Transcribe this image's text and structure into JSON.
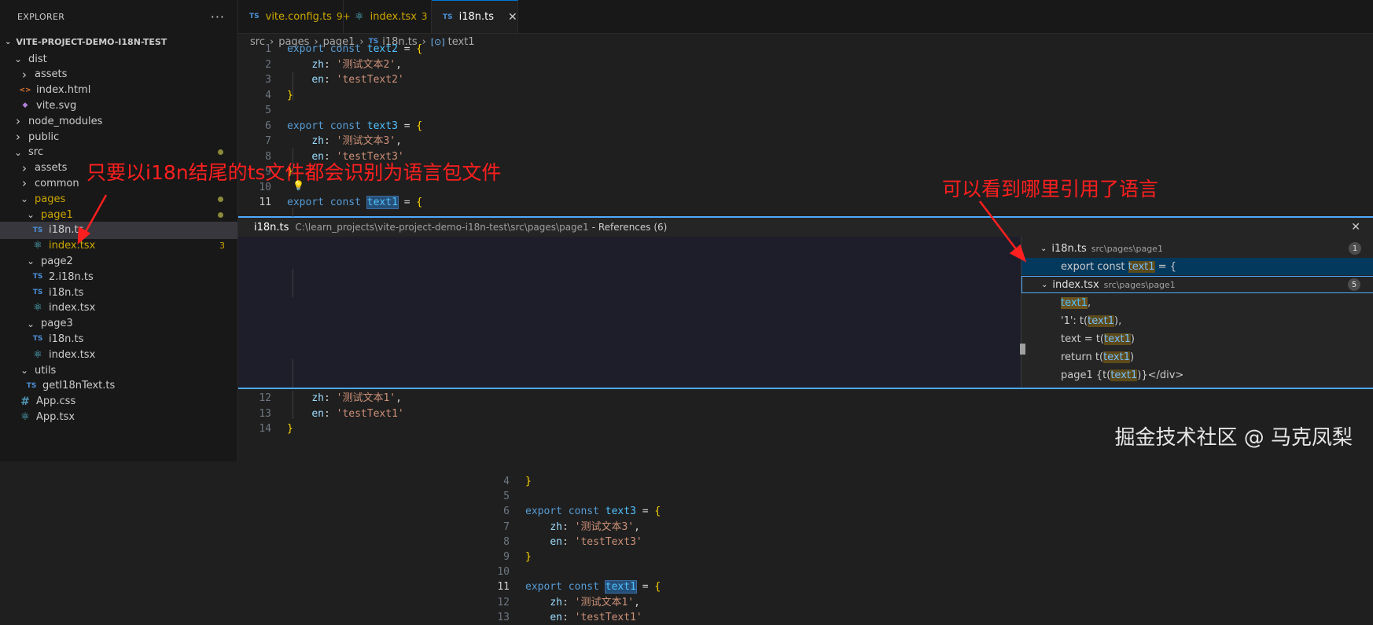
{
  "explorer": {
    "title": "EXPLORER",
    "more": "···",
    "project": "VITE-PROJECT-DEMO-I18N-TEST",
    "items": [
      {
        "label": "dist",
        "kind": "folder",
        "open": true,
        "depth": 0
      },
      {
        "label": "assets",
        "kind": "folder",
        "open": false,
        "depth": 1
      },
      {
        "label": "index.html",
        "kind": "html",
        "depth": 1
      },
      {
        "label": "vite.svg",
        "kind": "svg",
        "depth": 1
      },
      {
        "label": "node_modules",
        "kind": "folder",
        "open": false,
        "depth": 0
      },
      {
        "label": "public",
        "kind": "folder",
        "open": false,
        "depth": 0
      },
      {
        "label": "src",
        "kind": "folder",
        "open": true,
        "depth": 0,
        "modified": true
      },
      {
        "label": "assets",
        "kind": "folder",
        "open": false,
        "depth": 1
      },
      {
        "label": "common",
        "kind": "folder",
        "open": false,
        "depth": 1
      },
      {
        "label": "pages",
        "kind": "folder",
        "open": true,
        "depth": 1,
        "modified": true
      },
      {
        "label": "page1",
        "kind": "folder",
        "open": true,
        "depth": 2,
        "modified": true
      },
      {
        "label": "i18n.ts",
        "kind": "ts",
        "depth": 3,
        "selected": true
      },
      {
        "label": "index.tsx",
        "kind": "tsx",
        "depth": 3,
        "badge": "3",
        "modified": true
      },
      {
        "label": "page2",
        "kind": "folder",
        "open": true,
        "depth": 2
      },
      {
        "label": "2.i18n.ts",
        "kind": "ts",
        "depth": 3
      },
      {
        "label": "i18n.ts",
        "kind": "ts",
        "depth": 3
      },
      {
        "label": "index.tsx",
        "kind": "tsx",
        "depth": 3
      },
      {
        "label": "page3",
        "kind": "folder",
        "open": true,
        "depth": 2
      },
      {
        "label": "i18n.ts",
        "kind": "ts",
        "depth": 3
      },
      {
        "label": "index.tsx",
        "kind": "tsx",
        "depth": 3
      },
      {
        "label": "utils",
        "kind": "folder",
        "open": true,
        "depth": 1
      },
      {
        "label": "getI18nText.ts",
        "kind": "ts",
        "depth": 2
      },
      {
        "label": "App.css",
        "kind": "css",
        "depth": 1
      },
      {
        "label": "App.tsx",
        "kind": "tsx",
        "depth": 1
      }
    ]
  },
  "tabs": [
    {
      "label": "vite.config.ts",
      "count": "9+",
      "icon": "TS",
      "active": false
    },
    {
      "label": "index.tsx",
      "count": "3",
      "icon": "react",
      "active": false
    },
    {
      "label": "i18n.ts",
      "count": "",
      "icon": "TS",
      "active": true,
      "close": "✕"
    }
  ],
  "breadcrumb": {
    "parts": [
      "src",
      "pages",
      "page1"
    ],
    "file": "i18n.ts",
    "symbol": "text1"
  },
  "editor_top": [
    {
      "n": "1",
      "code": [
        [
          "kw",
          "export "
        ],
        [
          "kw",
          "const "
        ],
        [
          "var",
          "text2"
        ],
        [
          "pun",
          " = "
        ],
        [
          "brace",
          "{"
        ]
      ]
    },
    {
      "n": "2",
      "code": [
        [
          "pun",
          "    "
        ],
        [
          "prop",
          "zh"
        ],
        [
          "pun",
          ": "
        ],
        [
          "str",
          "'测试文本2'"
        ],
        [
          "pun",
          ","
        ]
      ]
    },
    {
      "n": "3",
      "code": [
        [
          "pun",
          "    "
        ],
        [
          "prop",
          "en"
        ],
        [
          "pun",
          ": "
        ],
        [
          "str",
          "'testText2'"
        ]
      ]
    },
    {
      "n": "4",
      "code": [
        [
          "brace",
          "}"
        ]
      ]
    },
    {
      "n": "5",
      "code": []
    },
    {
      "n": "6",
      "code": [
        [
          "kw",
          "export "
        ],
        [
          "kw",
          "const "
        ],
        [
          "var",
          "text3"
        ],
        [
          "pun",
          " = "
        ],
        [
          "brace",
          "{"
        ]
      ]
    },
    {
      "n": "7",
      "code": [
        [
          "pun",
          "    "
        ],
        [
          "prop",
          "zh"
        ],
        [
          "pun",
          ": "
        ],
        [
          "str",
          "'测试文本3'"
        ],
        [
          "pun",
          ","
        ]
      ]
    },
    {
      "n": "8",
      "code": [
        [
          "pun",
          "    "
        ],
        [
          "prop",
          "en"
        ],
        [
          "pun",
          ": "
        ],
        [
          "str",
          "'testText3'"
        ]
      ]
    },
    {
      "n": "9",
      "code": [
        [
          "brace",
          "}"
        ]
      ]
    },
    {
      "n": "10",
      "code": []
    },
    {
      "n": "11",
      "code": [
        [
          "kw",
          "export "
        ],
        [
          "kw",
          "const "
        ],
        [
          "var hl",
          "text1"
        ],
        [
          "pun",
          " = "
        ],
        [
          "brace",
          "{"
        ]
      ]
    }
  ],
  "peek": {
    "file": "i18n.ts",
    "path": "C:\\learn_projects\\vite-project-demo-i18n-test\\src\\pages\\page1",
    "title": "- References (6)",
    "close": "✕",
    "lines": [
      {
        "n": "4",
        "code": [
          [
            "brace",
            "}"
          ]
        ]
      },
      {
        "n": "5",
        "code": []
      },
      {
        "n": "6",
        "code": [
          [
            "kw",
            "export "
          ],
          [
            "kw",
            "const "
          ],
          [
            "var",
            "text3"
          ],
          [
            "pun",
            " = "
          ],
          [
            "brace",
            "{"
          ]
        ]
      },
      {
        "n": "7",
        "code": [
          [
            "pun",
            "    "
          ],
          [
            "prop",
            "zh"
          ],
          [
            "pun",
            ": "
          ],
          [
            "str",
            "'测试文本3'"
          ],
          [
            "pun",
            ","
          ]
        ]
      },
      {
        "n": "8",
        "code": [
          [
            "pun",
            "    "
          ],
          [
            "prop",
            "en"
          ],
          [
            "pun",
            ": "
          ],
          [
            "str",
            "'testText3'"
          ]
        ]
      },
      {
        "n": "9",
        "code": [
          [
            "brace",
            "}"
          ]
        ]
      },
      {
        "n": "10",
        "code": []
      },
      {
        "n": "11",
        "code": [
          [
            "kw",
            "export "
          ],
          [
            "kw",
            "const "
          ],
          [
            "var hl",
            "text1"
          ],
          [
            "pun",
            " = "
          ],
          [
            "brace",
            "{"
          ]
        ]
      },
      {
        "n": "12",
        "code": [
          [
            "pun",
            "    "
          ],
          [
            "prop",
            "zh"
          ],
          [
            "pun",
            ": "
          ],
          [
            "str",
            "'测试文本1'"
          ],
          [
            "pun",
            ","
          ]
        ]
      },
      {
        "n": "13",
        "code": [
          [
            "pun",
            "    "
          ],
          [
            "prop",
            "en"
          ],
          [
            "pun",
            ": "
          ],
          [
            "str",
            "'testText1'"
          ]
        ]
      }
    ],
    "refs": [
      {
        "file": "i18n.ts",
        "path": "src\\pages\\page1",
        "count": "1",
        "items": [
          {
            "pre": "export const ",
            "hit": "text1",
            "post": " = {",
            "selected": true
          }
        ]
      },
      {
        "file": "index.tsx",
        "path": "src\\pages\\page1",
        "count": "5",
        "items": [
          {
            "pre": "",
            "hit": "text1",
            "post": ","
          },
          {
            "pre": "'1': t(",
            "hit": "text1",
            "post": "),"
          },
          {
            "pre": "text = t(",
            "hit": "text1",
            "post": ")"
          },
          {
            "pre": "return t(",
            "hit": "text1",
            "post": ")"
          },
          {
            "pre": "page1 {t(",
            "hit": "text1",
            "post": ")}</div>"
          }
        ]
      }
    ]
  },
  "editor_bottom": [
    {
      "n": "12",
      "code": [
        [
          "pun",
          "    "
        ],
        [
          "prop",
          "zh"
        ],
        [
          "pun",
          ": "
        ],
        [
          "str",
          "'测试文本1'"
        ],
        [
          "pun",
          ","
        ]
      ]
    },
    {
      "n": "13",
      "code": [
        [
          "pun",
          "    "
        ],
        [
          "prop",
          "en"
        ],
        [
          "pun",
          ": "
        ],
        [
          "str",
          "'testText1'"
        ]
      ]
    },
    {
      "n": "14",
      "code": [
        [
          "brace",
          "}"
        ]
      ]
    }
  ],
  "annotations": {
    "left": "只要以i18n结尾的ts文件都会识别为语言包文件",
    "right": "可以看到哪里引用了语言"
  },
  "watermark": "掘金技术社区 @ 马克凤梨",
  "colors": {
    "accent": "#0078d4",
    "annotation": "#ff1f1f",
    "peek_border": "#4daafc"
  }
}
